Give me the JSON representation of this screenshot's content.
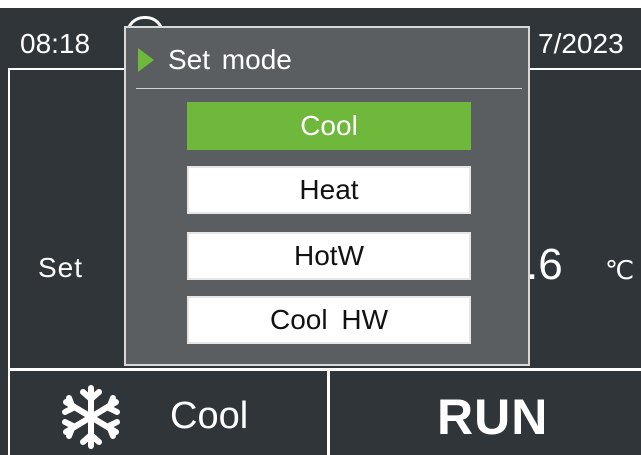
{
  "status": {
    "time": "08:18",
    "date": "7/2023"
  },
  "main": {
    "set_label": "Set",
    "temperature": ".6",
    "unit": "℃"
  },
  "bottom": {
    "mode": "Cool",
    "mode_icon": "snowflake-icon",
    "run": "RUN"
  },
  "dialog": {
    "title": "Set mode",
    "selected_index": 0,
    "options": [
      {
        "label": "Cool"
      },
      {
        "label": "Heat"
      },
      {
        "label": "HotW"
      },
      {
        "label": "Cool HW"
      }
    ]
  },
  "colors": {
    "background": "#2f3538",
    "dialog_bg": "#5a5e61",
    "accent": "#6fb83b",
    "text": "#ffffff"
  }
}
